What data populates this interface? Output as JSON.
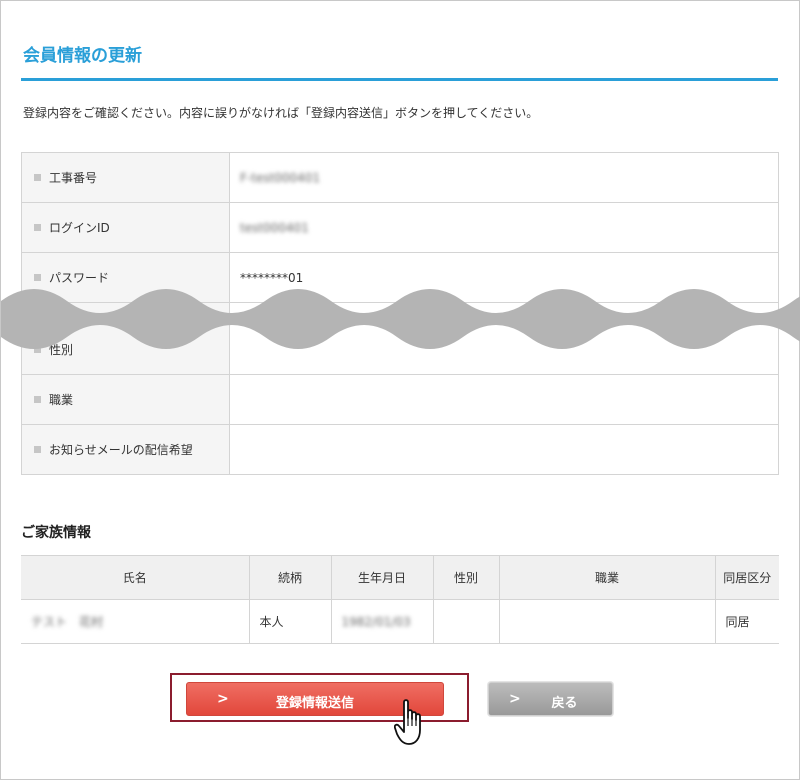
{
  "page": {
    "title": "会員情報の更新",
    "instruction": "登録内容をご確認ください。内容に誤りがなければ「登録内容送信」ボタンを押してください。"
  },
  "member_info": {
    "rows": [
      {
        "label": "工事番号",
        "value": "F-test000401",
        "blurred": true
      },
      {
        "label": "ログインID",
        "value": "test000401",
        "blurred": true
      },
      {
        "label": "パスワード",
        "value": "********01",
        "blurred": false
      },
      {
        "label": "性別",
        "value": "",
        "blurred": false
      },
      {
        "label": "職業",
        "value": "",
        "blurred": false
      },
      {
        "label": "お知らせメールの配信希望",
        "value": "",
        "blurred": false
      }
    ]
  },
  "family": {
    "title": "ご家族情報",
    "headers": [
      "氏名",
      "続柄",
      "生年月日",
      "性別",
      "職業",
      "同居区分"
    ],
    "rows": [
      [
        "テスト　花村",
        "本人",
        "1982/01/03",
        "",
        "",
        "同居"
      ]
    ]
  },
  "buttons": {
    "submit_label": "登録情報送信",
    "back_label": "戻る",
    "chevron": ">"
  },
  "colors": {
    "accent_blue": "#2a9fd8",
    "submit_red": "#e8554a",
    "back_gray": "#aaaaaa",
    "highlight_border": "#8b1c2e"
  }
}
